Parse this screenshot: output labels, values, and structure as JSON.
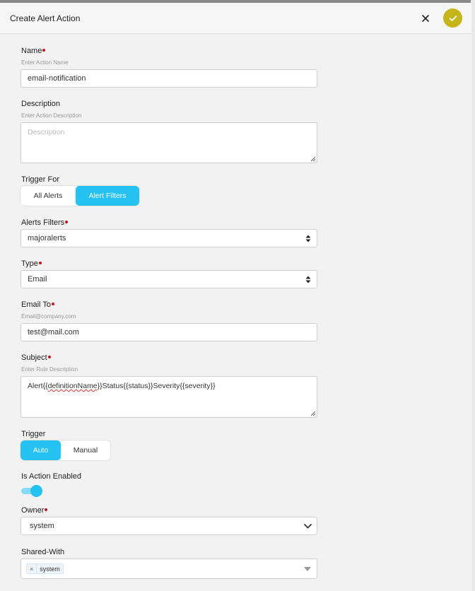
{
  "dialog": {
    "title": "Create Alert Action"
  },
  "fields": {
    "name": {
      "label": "Name",
      "hint": "Enter Action Name",
      "value": "email-notification"
    },
    "description": {
      "label": "Description",
      "hint": "Enter Action Description",
      "placeholder": "Description"
    },
    "trigger_for": {
      "label": "Trigger For",
      "options": [
        "All Alerts",
        "Alert Filters"
      ],
      "selected": "Alert Filters"
    },
    "alerts_filters": {
      "label": "Alerts Filters",
      "value": "majoralerts"
    },
    "type": {
      "label": "Type",
      "value": "Email"
    },
    "email_to": {
      "label": "Email To",
      "hint": "Email@company.com",
      "value": "test@mail.com"
    },
    "subject": {
      "label": "Subject",
      "hint": "Enter Rule Description",
      "value_prefix": "Alert{{",
      "value_spell": "definitionName",
      "value_suffix": "}}Status{{status}}Severity{{severity}}"
    },
    "trigger": {
      "label": "Trigger",
      "options": [
        "Auto",
        "Manual"
      ],
      "selected": "Auto"
    },
    "is_action_enabled": {
      "label": "Is Action Enabled",
      "enabled": true
    },
    "owner": {
      "label": "Owner",
      "value": "system"
    },
    "shared_with": {
      "label": "Shared-With",
      "chips": [
        "system"
      ]
    }
  },
  "colors": {
    "accent": "#25c2f2",
    "confirm": "#c3b51a",
    "required": "#c01818"
  },
  "icons": {
    "close": "close-icon",
    "confirm": "check-icon",
    "select": "sort-arrows-icon",
    "owner_select": "chevron-down-icon",
    "shared_select": "caret-down-icon"
  }
}
